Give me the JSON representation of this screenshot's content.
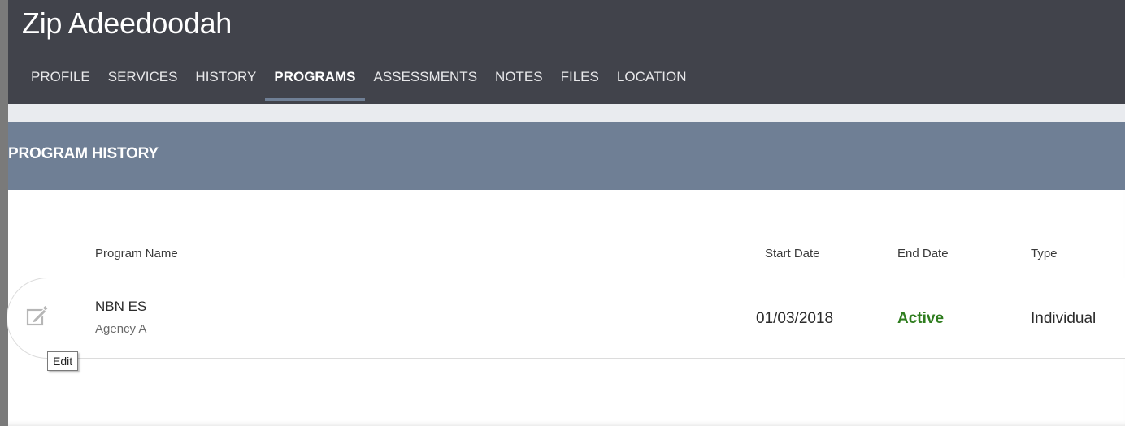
{
  "client": {
    "name": "Zip Adeedoodah"
  },
  "tabs": [
    {
      "label": "PROFILE",
      "active": false
    },
    {
      "label": "SERVICES",
      "active": false
    },
    {
      "label": "HISTORY",
      "active": false
    },
    {
      "label": "PROGRAMS",
      "active": true
    },
    {
      "label": "ASSESSMENTS",
      "active": false
    },
    {
      "label": "NOTES",
      "active": false
    },
    {
      "label": "FILES",
      "active": false
    },
    {
      "label": "LOCATION",
      "active": false
    }
  ],
  "section": {
    "title": "PROGRAM HISTORY"
  },
  "table": {
    "columns": {
      "program_name": "Program Name",
      "start_date": "Start Date",
      "end_date": "End Date",
      "type": "Type"
    },
    "rows": [
      {
        "program_name": "NBN ES",
        "agency": "Agency A",
        "start_date": "01/03/2018",
        "end_date": "Active",
        "type": "Individual"
      }
    ]
  },
  "tooltip": {
    "text": "Edit"
  },
  "icons": {
    "edit": "edit-icon"
  },
  "colors": {
    "topbar": "#41434b",
    "section_header": "#6f7f95",
    "active_status": "#2f7d1f",
    "tab_underline": "#6f7f95"
  }
}
